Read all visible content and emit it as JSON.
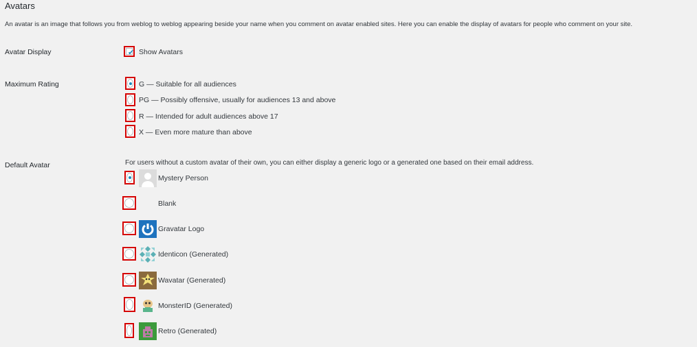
{
  "section": {
    "title": "Avatars",
    "description": "An avatar is an image that follows you from weblog to weblog appearing beside your name when you comment on avatar enabled sites. Here you can enable the display of avatars for people who comment on your site."
  },
  "avatar_display": {
    "label": "Avatar Display",
    "checkbox_label": "Show Avatars",
    "checked": true
  },
  "maximum_rating": {
    "label": "Maximum Rating",
    "options": [
      {
        "label": "G — Suitable for all audiences",
        "selected": true
      },
      {
        "label": "PG — Possibly offensive, usually for audiences 13 and above",
        "selected": false
      },
      {
        "label": "R — Intended for adult audiences above 17",
        "selected": false
      },
      {
        "label": "X — Even more mature than above",
        "selected": false
      }
    ]
  },
  "default_avatar": {
    "label": "Default Avatar",
    "description": "For users without a custom avatar of their own, you can either display a generic logo or a generated one based on their email address.",
    "options": [
      {
        "label": "Mystery Person",
        "icon": "mystery-person-icon",
        "selected": true
      },
      {
        "label": "Blank",
        "icon": "blank-icon",
        "selected": false
      },
      {
        "label": "Gravatar Logo",
        "icon": "gravatar-logo-icon",
        "selected": false
      },
      {
        "label": "Identicon (Generated)",
        "icon": "identicon-icon",
        "selected": false
      },
      {
        "label": "Wavatar (Generated)",
        "icon": "wavatar-icon",
        "selected": false
      },
      {
        "label": "MonsterID (Generated)",
        "icon": "monsterid-icon",
        "selected": false
      },
      {
        "label": "Retro (Generated)",
        "icon": "retro-icon",
        "selected": false
      }
    ]
  },
  "colors": {
    "highlight_border": "#d40000",
    "accent": "#1e8cbe",
    "background": "#f1f1f1"
  }
}
